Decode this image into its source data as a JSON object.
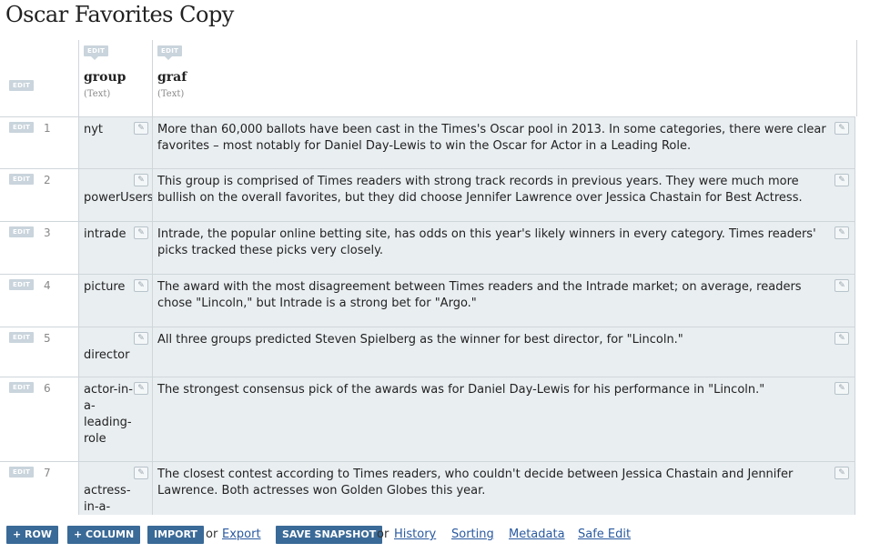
{
  "page": {
    "title": "Oscar Favorites Copy"
  },
  "edit_label": "EDIT",
  "columns": [
    {
      "name": "group",
      "type": "(Text)"
    },
    {
      "name": "graf",
      "type": "(Text)"
    }
  ],
  "rows": [
    {
      "num": "1",
      "group": "nyt",
      "graf": "More than 60,000 ballots have been cast in the Times's Oscar pool in 2013. In some categories, there were clear favorites – most notably for Daniel Day-Lewis to win the Oscar for Actor in a Leading Role."
    },
    {
      "num": "2",
      "group": "powerUsers",
      "graf": "This group is comprised of Times readers with strong track records in previous years. They were much more bullish on the overall favorites, but they did choose Jennifer Lawrence over Jessica Chastain for Best Actress."
    },
    {
      "num": "3",
      "group": "intrade",
      "graf": "Intrade, the popular online betting site, has odds on this year's likely winners in every category. Times readers' picks tracked these picks very closely."
    },
    {
      "num": "4",
      "group": "picture",
      "graf": "The award with the most disagreement between Times readers and the Intrade market; on average, readers chose \"Lincoln,\" but Intrade is a strong bet for \"Argo.\""
    },
    {
      "num": "5",
      "group": "director",
      "graf": "All three groups predicted Steven Spielberg as the winner for best director, for \"Lincoln.\""
    },
    {
      "num": "6",
      "group": "actor-in-a-leading-role",
      "graf": "The strongest consensus pick of the awards was for Daniel Day-Lewis for his performance in \"Lincoln.\""
    },
    {
      "num": "7",
      "group": "actress-in-a-",
      "graf": "The closest contest according to Times readers, who couldn't decide between Jessica Chastain and Jennifer Lawrence. Both actresses won Golden Globes this year."
    }
  ],
  "toolbar": {
    "add_row": "+ ROW",
    "add_column": "+ COLUMN",
    "import": "IMPORT",
    "or1": "or",
    "export": "Export",
    "save_snapshot": "SAVE SNAPSHOT",
    "or2": "or",
    "history": "History",
    "sorting": "Sorting",
    "metadata": "Metadata",
    "safe_edit": "Safe Edit"
  },
  "icons": {
    "pencil": "pencil-icon"
  }
}
